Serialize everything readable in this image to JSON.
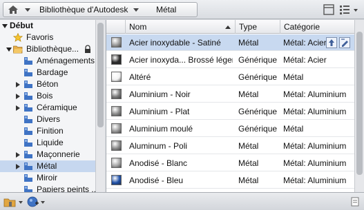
{
  "breadcrumb": {
    "items": [
      "Bibliothèque d'Autodesk",
      "Métal"
    ]
  },
  "tree": {
    "root_label": "Début",
    "items": [
      {
        "label": "Favoris",
        "icon": "star-icon",
        "expander": "none"
      },
      {
        "label": "Bibliothèque...",
        "icon": "folder-open-icon",
        "expander": "down",
        "locked": true
      },
      {
        "label": "Aménagements",
        "icon": "category-icon",
        "expander": "none"
      },
      {
        "label": "Bardage",
        "icon": "category-icon",
        "expander": "none"
      },
      {
        "label": "Béton",
        "icon": "category-icon",
        "expander": "right"
      },
      {
        "label": "Bois",
        "icon": "category-icon",
        "expander": "right"
      },
      {
        "label": "Céramique",
        "icon": "category-icon",
        "expander": "right"
      },
      {
        "label": "Divers",
        "icon": "category-icon",
        "expander": "none"
      },
      {
        "label": "Finition",
        "icon": "category-icon",
        "expander": "none"
      },
      {
        "label": "Liquide",
        "icon": "category-icon",
        "expander": "none"
      },
      {
        "label": "Maçonnerie",
        "icon": "category-icon",
        "expander": "right"
      },
      {
        "label": "Métal",
        "icon": "category-icon",
        "expander": "right",
        "selected": true
      },
      {
        "label": "Miroir",
        "icon": "category-icon",
        "expander": "none"
      },
      {
        "label": "Papiers peints ...",
        "icon": "category-icon",
        "expander": "none"
      }
    ]
  },
  "list": {
    "columns": [
      "Nom",
      "Type",
      "Catégorie"
    ],
    "rows": [
      {
        "name": "Acier inoxydable - Satiné",
        "type": "Métal",
        "category": "Métal: Acier",
        "swatch": "#9a9a9a",
        "selected": true
      },
      {
        "name": "Acier inoxyda... Brossé léger",
        "type": "Générique",
        "category": "Métal: Acier",
        "swatch": "#2b2b2b"
      },
      {
        "name": "Altéré",
        "type": "Générique",
        "category": "Métal",
        "swatch": "#f2f2f2"
      },
      {
        "name": "Aluminium - Noir",
        "type": "Métal",
        "category": "Métal: Aluminium",
        "swatch": "#7a7a7a"
      },
      {
        "name": "Aluminium - Plat",
        "type": "Générique",
        "category": "Métal: Aluminium",
        "swatch": "#8a8a8a"
      },
      {
        "name": "Aluminium moulé",
        "type": "Générique",
        "category": "Métal",
        "swatch": "#999999"
      },
      {
        "name": "Aluminum - Poli",
        "type": "Métal",
        "category": "Métal: Aluminium",
        "swatch": "#8c8c8c"
      },
      {
        "name": "Anodisé - Blanc",
        "type": "Métal",
        "category": "Métal: Aluminium",
        "swatch": "#a8a8a8"
      },
      {
        "name": "Anodisé - Bleu",
        "type": "Métal",
        "category": "Métal: Aluminium",
        "swatch": "#1e4fa6"
      }
    ]
  },
  "colors": {
    "selection": "#c8d9f0",
    "accent": "#3f73c4"
  }
}
